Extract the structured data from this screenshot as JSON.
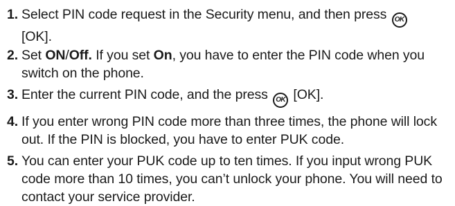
{
  "ok_key": {
    "label": "OK"
  },
  "steps": [
    {
      "number": "1.",
      "text_a": "Select PIN code request in the Security menu, and then press",
      "text_b": "[OK]."
    },
    {
      "number": "2.",
      "text_a": "Set",
      "bold_on": "ON",
      "slash": "/",
      "bold_off": "Off.",
      "text_b": "If you set",
      "bold_on2": "On",
      "text_c": ", you have to enter the PIN code when you switch on the phone."
    },
    {
      "number": "3.",
      "text_a": "Enter the current PIN code, and the press",
      "text_b": "[OK]."
    },
    {
      "number": "4.",
      "text": "If you enter wrong PIN code more than three times, the phone will lock out. If the PIN is blocked, you have to enter PUK code."
    },
    {
      "number": "5.",
      "text": "You can enter your PUK code up to ten times. If you input wrong PUK code more than 10 times, you can’t unlock your phone. You will need to contact your service provider."
    }
  ]
}
